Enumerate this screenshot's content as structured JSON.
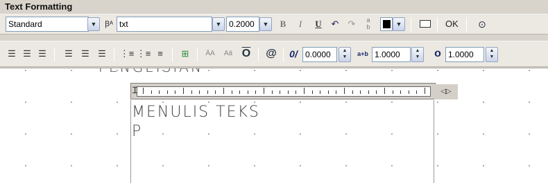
{
  "toolbar": {
    "title": "Text Formatting",
    "style_value": "Standard",
    "font_value": "txt",
    "height_value": "0.2000",
    "bold_label": "B",
    "italic_label": "I",
    "underline_label": "U",
    "ok_label": "OK",
    "color_swatch": "#000000",
    "oblique_value": "0.0000",
    "tracking_value": "1.0000",
    "width_value": "1.0000",
    "tracking_icon_label": "a+b",
    "oblique_icon_label": "0/",
    "at_label": "@",
    "upper_label": "ÄA",
    "lower_label": "Aä",
    "overline_label": "O"
  },
  "drawing": {
    "partial_text": "PENGEISIAN",
    "line1": "MENULIS  TEKS",
    "line2": "P"
  },
  "icons": [
    "style-dropdown-icon",
    "font-icon",
    "bold-icon",
    "italic-icon",
    "underline-icon",
    "undo-icon",
    "redo-icon",
    "stack-icon",
    "color-icon",
    "ruler-icon",
    "options-icon",
    "align-left-icon",
    "align-center-icon",
    "align-right-icon",
    "justify-icon",
    "numbering-icon",
    "bullets-icon",
    "list-icon",
    "insert-field-icon",
    "uppercase-icon",
    "lowercase-icon",
    "overline-icon",
    "symbol-icon",
    "oblique-icon",
    "tracking-icon",
    "width-factor-icon"
  ]
}
